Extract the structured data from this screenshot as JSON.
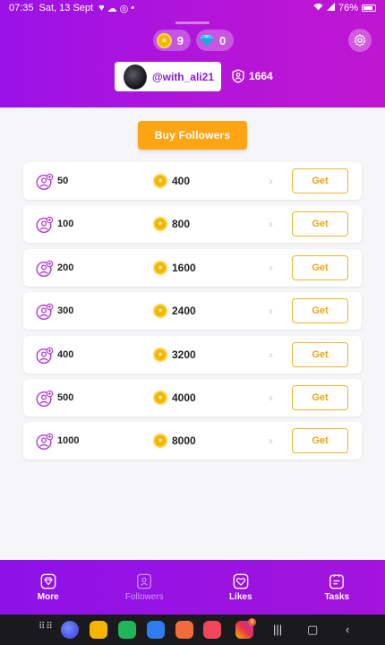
{
  "status_bar": {
    "time": "07:35",
    "date": "Sat, 13 Sept",
    "battery": "76%"
  },
  "header": {
    "coins": "9",
    "gems": "0",
    "username": "@with_ali21",
    "followers": "1664"
  },
  "buy_button": {
    "label": "Buy Followers"
  },
  "offers": [
    {
      "amount": "50",
      "price": "400",
      "button": "Get"
    },
    {
      "amount": "100",
      "price": "800",
      "button": "Get"
    },
    {
      "amount": "200",
      "price": "1600",
      "button": "Get"
    },
    {
      "amount": "300",
      "price": "2400",
      "button": "Get"
    },
    {
      "amount": "400",
      "price": "3200",
      "button": "Get"
    },
    {
      "amount": "500",
      "price": "4000",
      "button": "Get"
    },
    {
      "amount": "1000",
      "price": "8000",
      "button": "Get"
    }
  ],
  "bottom_nav": [
    {
      "label": "More",
      "icon": "gem-icon"
    },
    {
      "label": "Followers",
      "icon": "followers-icon",
      "active": true
    },
    {
      "label": "Likes",
      "icon": "heart-icon"
    },
    {
      "label": "Tasks",
      "icon": "tasks-icon"
    }
  ],
  "system_bar": {
    "instagram_badge": "9"
  },
  "colors": {
    "header_start": "#9a12e8",
    "header_end": "#c016d2",
    "accent_orange": "#ffa514",
    "coin_gold": "#f4b400",
    "get_border": "#f0b429",
    "nav_bg": "#8d12e8"
  }
}
